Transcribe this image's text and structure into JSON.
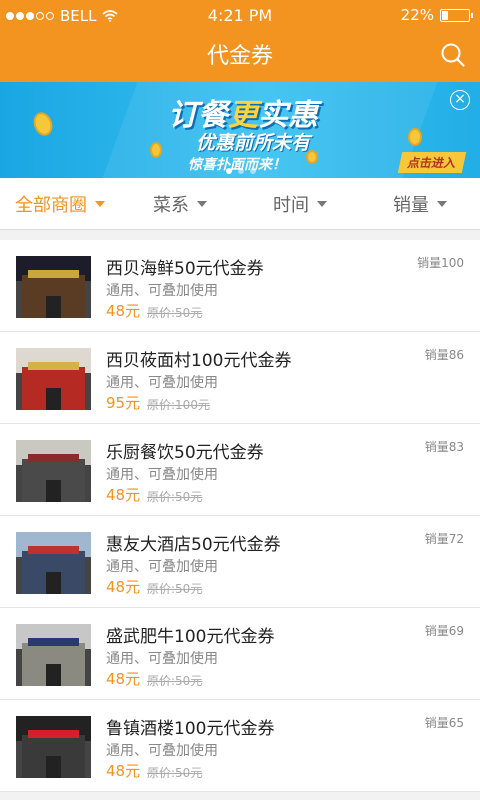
{
  "status_bar": {
    "carrier": "BELL",
    "time": "4:21 PM",
    "battery": "22%",
    "battery_level": 0.22
  },
  "nav": {
    "title": "代金券",
    "search_icon": "search-icon"
  },
  "banner": {
    "headline_a": "订餐",
    "headline_b": "更",
    "headline_c": "实惠",
    "subline": "优惠前所未有",
    "small": "惊喜扑面而来！",
    "enter": "点击进入",
    "close_icon": "close-icon",
    "pager_count": 3,
    "pager_active": 0
  },
  "filters": [
    {
      "label": "全部商圈",
      "active": true
    },
    {
      "label": "菜系",
      "active": false
    },
    {
      "label": "时间",
      "active": false
    },
    {
      "label": "销量",
      "active": false
    }
  ],
  "colors": {
    "accent": "#f39320",
    "banner_blue": "#1aa6e3"
  },
  "vouchers": [
    {
      "title": "西贝海鲜50元代金券",
      "desc": "通用、可叠加使用",
      "price": "48元",
      "original": "原价:50元",
      "sales": "销量100"
    },
    {
      "title": "西贝莜面村100元代金券",
      "desc": "通用、可叠加使用",
      "price": "95元",
      "original": "原价:100元",
      "sales": "销量86"
    },
    {
      "title": "乐厨餐饮50元代金券",
      "desc": "通用、可叠加使用",
      "price": "48元",
      "original": "原价:50元",
      "sales": "销量83"
    },
    {
      "title": "惠友大酒店50元代金券",
      "desc": "通用、可叠加使用",
      "price": "48元",
      "original": "原价:50元",
      "sales": "销量72"
    },
    {
      "title": "盛武肥牛100元代金券",
      "desc": "通用、可叠加使用",
      "price": "48元",
      "original": "原价:50元",
      "sales": "销量69"
    },
    {
      "title": "鲁镇酒楼100元代金券",
      "desc": "通用、可叠加使用",
      "price": "48元",
      "original": "原价:50元",
      "sales": "销量65"
    }
  ]
}
